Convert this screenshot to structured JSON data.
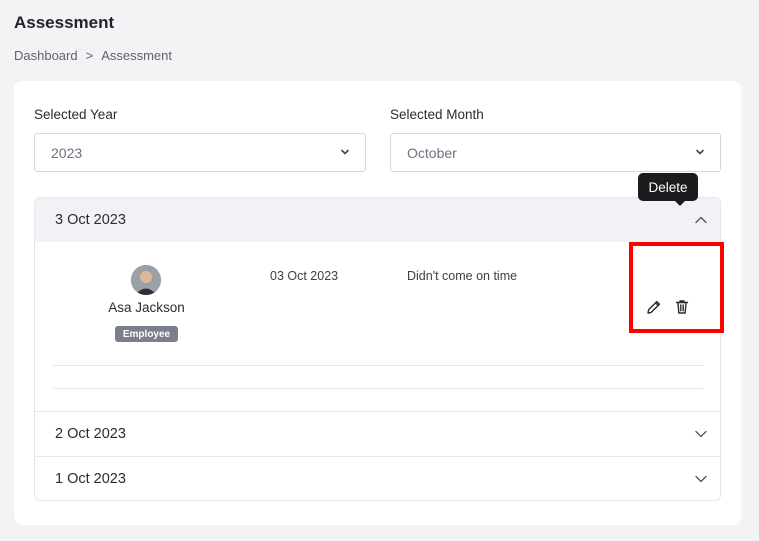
{
  "header": {
    "title": "Assessment",
    "breadcrumb": [
      "Dashboard",
      "Assessment"
    ],
    "breadcrumb_separator": ">"
  },
  "filters": {
    "year_label": "Selected Year",
    "year_value": "2023",
    "month_label": "Selected Month",
    "month_value": "October"
  },
  "accordion": {
    "sections": [
      {
        "title": "3 Oct 2023",
        "expanded": true
      },
      {
        "title": "2 Oct 2023",
        "expanded": false
      },
      {
        "title": "1 Oct 2023",
        "expanded": false
      }
    ],
    "record": {
      "employee_name": "Asa Jackson",
      "role_badge": "Employee",
      "date": "03 Oct 2023",
      "reason": "Didn't come on time"
    }
  },
  "actions": {
    "tooltip": "Delete",
    "edit_icon": "pencil-icon",
    "delete_icon": "trash-icon"
  },
  "colors": {
    "highlight": "#ff0000",
    "tooltip_bg": "#1c1c1f",
    "badge_bg": "#7b7f8c"
  }
}
